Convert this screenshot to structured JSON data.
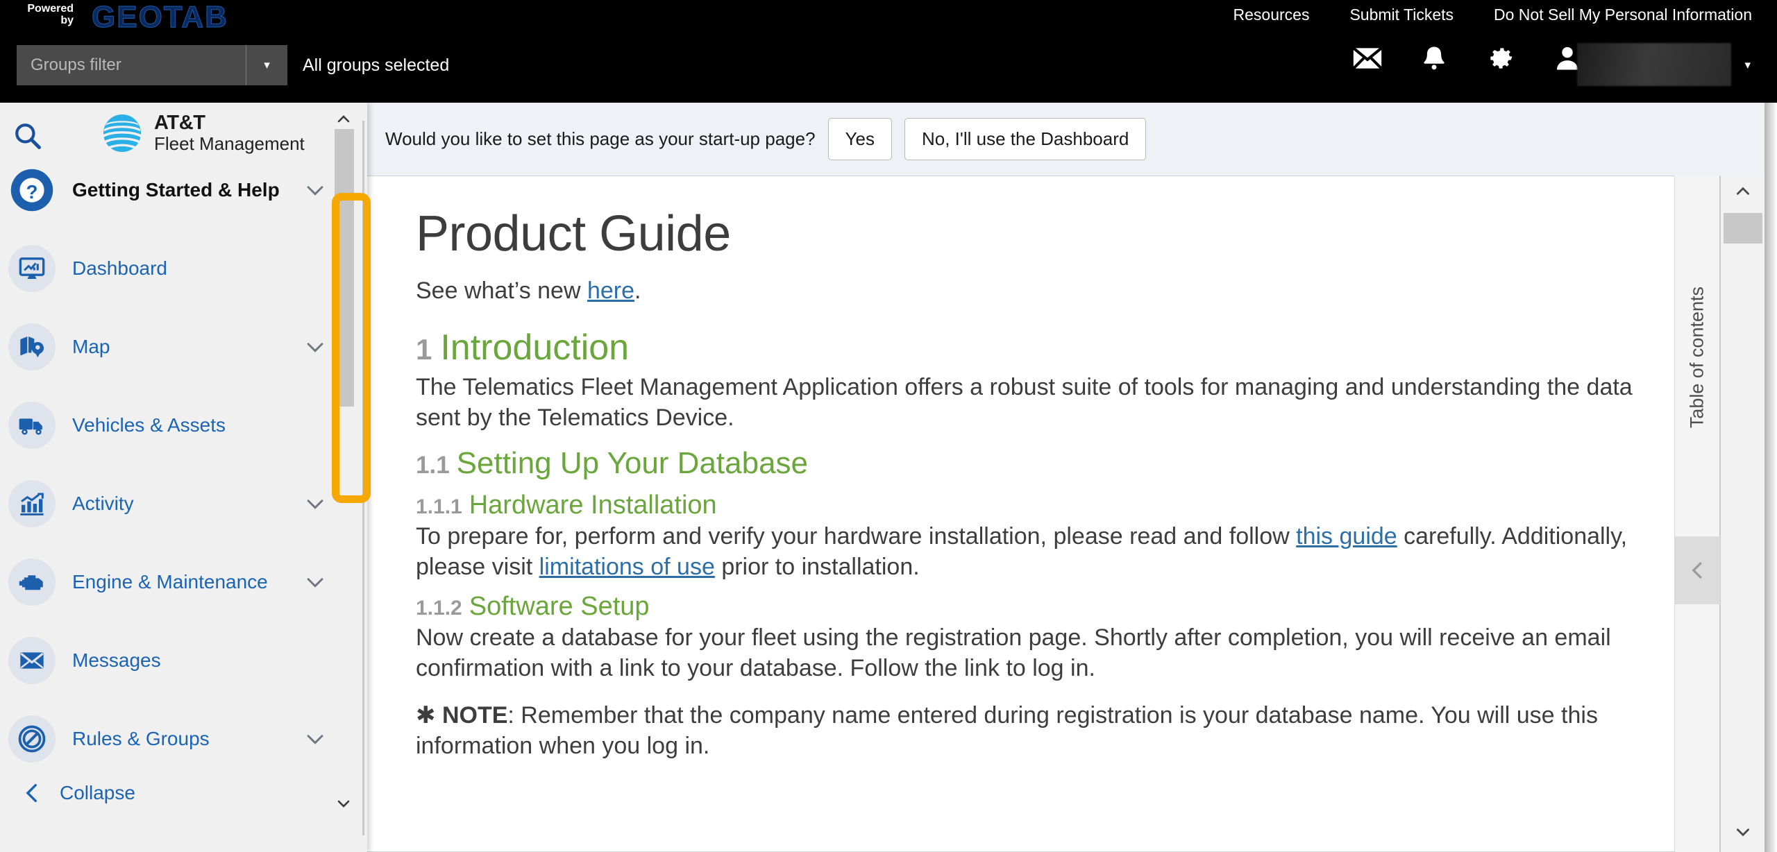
{
  "topbar": {
    "powered_line1": "Powered",
    "powered_line2": "by",
    "brand": "GEOTAB",
    "links": [
      {
        "label": "Resources"
      },
      {
        "label": "Submit Tickets"
      },
      {
        "label": "Do Not Sell My Personal Information"
      }
    ],
    "groups_filter_placeholder": "Groups filter",
    "groups_filter_value": "",
    "groups_status": "All groups selected",
    "icons": [
      {
        "name": "mail-icon"
      },
      {
        "name": "bell-icon"
      },
      {
        "name": "gear-icon"
      },
      {
        "name": "user-icon"
      }
    ],
    "user_caret": "▾",
    "dropdown_caret": "▾"
  },
  "sidebar": {
    "search_icon": "search-icon",
    "logo": {
      "line1": "AT&T",
      "line2": "Fleet Management"
    },
    "items": [
      {
        "label": "Getting Started & Help",
        "icon": "question-circle-icon",
        "chevron": true,
        "active": true
      },
      {
        "label": "Dashboard",
        "icon": "dashboard-monitor-icon",
        "chevron": false,
        "active": false
      },
      {
        "label": "Map",
        "icon": "map-pin-icon",
        "chevron": true,
        "active": false
      },
      {
        "label": "Vehicles & Assets",
        "icon": "truck-icon",
        "chevron": false,
        "active": false
      },
      {
        "label": "Activity",
        "icon": "bar-chart-icon",
        "chevron": true,
        "active": false
      },
      {
        "label": "Engine & Maintenance",
        "icon": "engine-icon",
        "chevron": true,
        "active": false
      },
      {
        "label": "Messages",
        "icon": "envelope-icon",
        "chevron": false,
        "active": false
      },
      {
        "label": "Rules & Groups",
        "icon": "no-entry-icon",
        "chevron": true,
        "active": false
      }
    ],
    "collapse_label": "Collapse"
  },
  "startup_prompt": {
    "question": "Would you like to set this page as your start-up page?",
    "yes_label": "Yes",
    "no_label": "No, I'll use the Dashboard"
  },
  "document": {
    "title": "Product Guide",
    "see_new_prefix": "See what’s new ",
    "see_new_link": "here",
    "see_new_suffix": ".",
    "sections": [
      {
        "num": "1",
        "heading": "Introduction",
        "paragraph": "The Telematics Fleet Management Application offers a robust suite of tools for managing and understanding the data sent by the Telematics Device."
      },
      {
        "num": "1.1",
        "heading": "Setting Up Your Database"
      },
      {
        "num": "1.1.1",
        "heading": "Hardware Installation",
        "p_part1": "To prepare for, perform and verify your hardware installation, please read and follow ",
        "p_link1": "this guide",
        "p_part2": " carefully. Additionally, please visit ",
        "p_link2": "limitations of use",
        "p_part3": " prior to installation."
      },
      {
        "num": "1.1.2",
        "heading": "Software Setup",
        "paragraph": "Now create a database for your fleet using the registration page. Shortly after completion, you will receive an email confirmation with a link to your database. Follow the link to log in.",
        "note_marker": "✱",
        "note_label": "NOTE",
        "note_text": ": Remember that the company name entered during registration is your database name. You will use this information when you log in."
      }
    ]
  },
  "toc": {
    "label": "Table of contents",
    "collapse_icon": "chevron-left-icon"
  },
  "colors": {
    "accent_green": "#6aa63b",
    "link_blue": "#2c6fa8",
    "sidebar_blue": "#1b63b3",
    "highlight_orange": "#f7a800",
    "att_blue": "#2ab0e6"
  }
}
